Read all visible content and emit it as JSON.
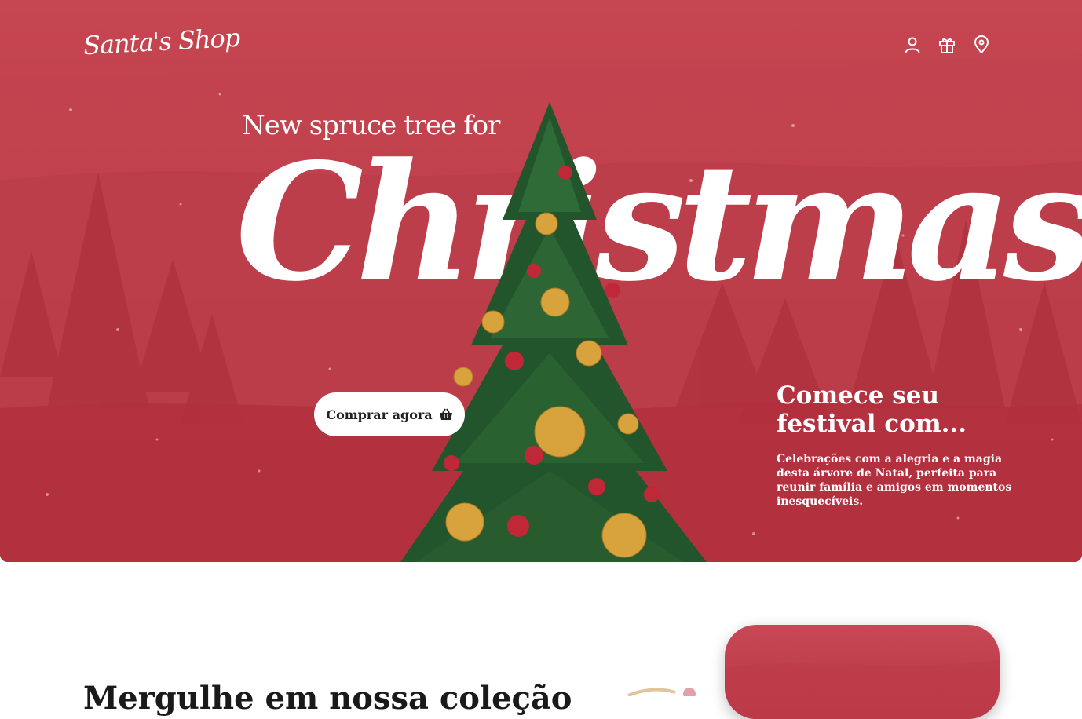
{
  "header": {
    "logo": "Santa's Shop",
    "icons": [
      "user-icon",
      "gift-icon",
      "location-pin-icon"
    ]
  },
  "hero": {
    "subtitle": "New spruce tree for",
    "headline": "Christmas",
    "cta_label": "Comprar agora",
    "cta_icon": "shopping-basket-icon",
    "side_title": "Comece seu festival com...",
    "side_text": "Celebrações com a alegria e a magia desta árvore de Natal, perfeita para reunir família e amigos em momentos inesquecíveis."
  },
  "collection": {
    "title": "Mergulhe em nossa coleção"
  },
  "colors": {
    "hero_background": "#c0404c",
    "text_light": "#ffffff",
    "text_dark": "#1a1a1a"
  }
}
